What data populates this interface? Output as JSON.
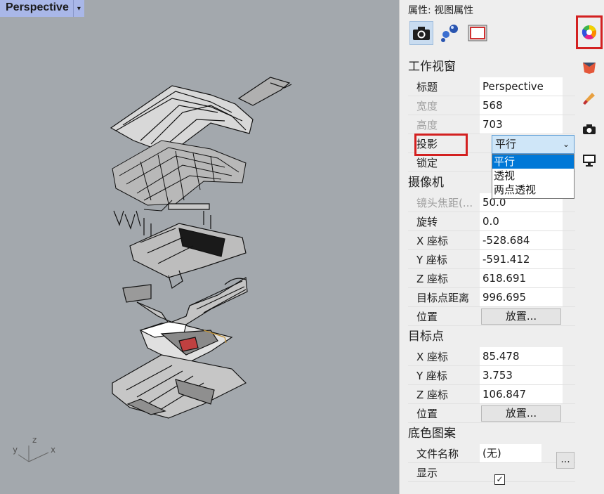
{
  "viewport": {
    "title": "Perspective",
    "menu_arrow": "▾",
    "axes": {
      "x": "x",
      "y": "y",
      "z": "z"
    }
  },
  "panel": {
    "title": "属性: 视图属性",
    "mode_icons": [
      "camera-icon",
      "spheres-icon",
      "frame-icon"
    ],
    "side_icons": [
      "color-wheel-icon",
      "layer-icon",
      "brush-icon",
      "camera-icon",
      "monitor-icon"
    ],
    "viewport_section": {
      "heading": "工作视窗",
      "title_label": "标题",
      "title_value": "Perspective",
      "width_label": "宽度",
      "width_value": "568",
      "height_label": "高度",
      "height_value": "703",
      "projection_label": "投影",
      "projection_value": "平行",
      "lock_label": "锁定"
    },
    "projection_options": [
      "平行",
      "透视",
      "两点透视"
    ],
    "camera_section": {
      "heading": "摄像机",
      "focal_label": "镜头焦距(...",
      "focal_value": "50.0",
      "rotation_label": "旋转",
      "rotation_value": "0.0",
      "x_label": "X 座标",
      "x_value": "-528.684",
      "y_label": "Y 座标",
      "y_value": "-591.412",
      "z_label": "Z 座标",
      "z_value": "618.691",
      "distance_label": "目标点距离",
      "distance_value": "996.695",
      "position_label": "位置",
      "place_button": "放置..."
    },
    "target_section": {
      "heading": "目标点",
      "x_label": "X 座标",
      "x_value": "85.478",
      "y_label": "Y 座标",
      "y_value": "3.753",
      "z_label": "Z 座标",
      "z_value": "106.847",
      "position_label": "位置",
      "place_button": "放置..."
    },
    "wallpaper_section": {
      "heading": "底色图案",
      "file_label": "文件名称",
      "file_value": "(无)",
      "file_button": "...",
      "show_label": "显示",
      "show_checked": "✓"
    }
  },
  "colors": {
    "highlight": "#d32020",
    "selected": "#0078d7",
    "viewport_bg": "#a3a8ad",
    "tab_bg": "#a9b7e8"
  }
}
